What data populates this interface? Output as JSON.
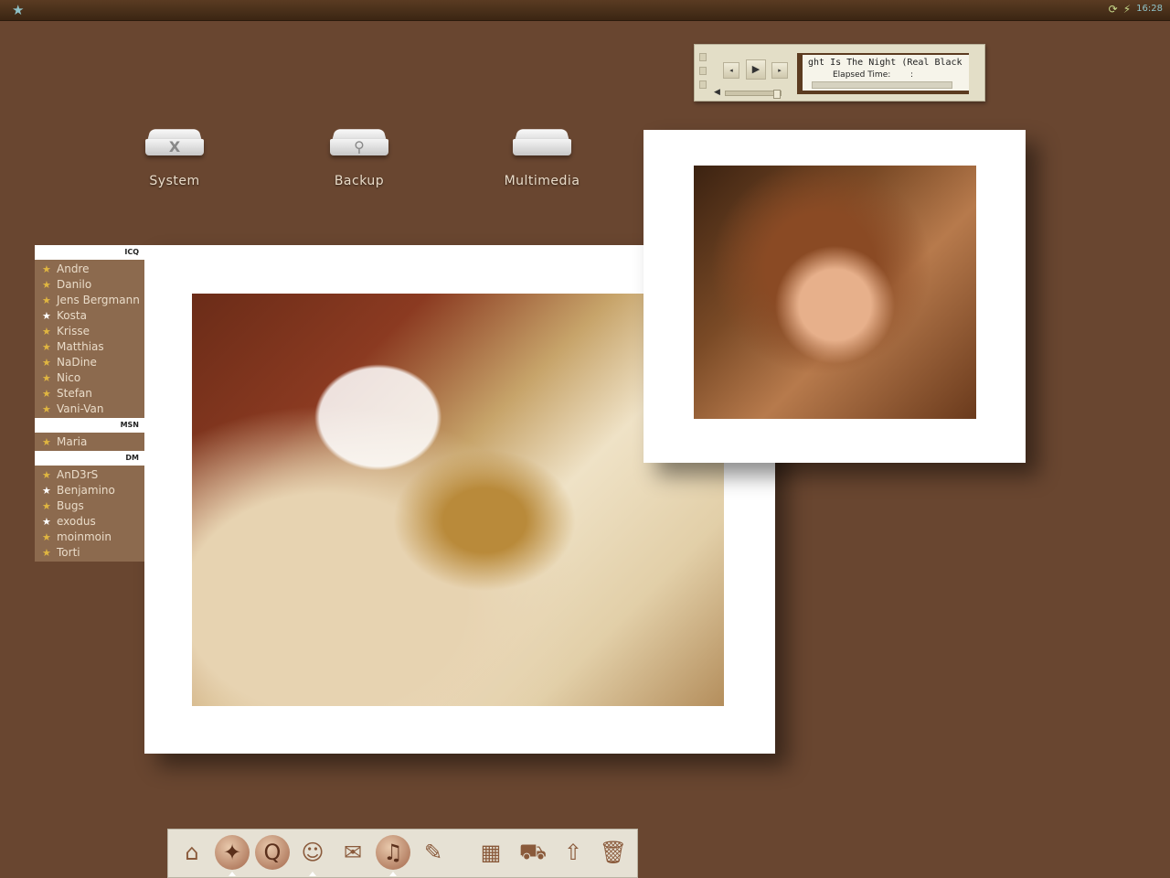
{
  "menubar": {
    "left_icon": "star-icon",
    "tray": [
      {
        "icon": "refresh-icon",
        "glyph": "⟳"
      },
      {
        "icon": "lightning-icon",
        "glyph": "⚡"
      }
    ],
    "clock": "16:28"
  },
  "player": {
    "title": "ght Is The Night (Real Black",
    "elapsed_label": "Elapsed Time:",
    "elapsed_value": ":",
    "controls": {
      "prev": "◂",
      "play": "▶",
      "next": "▸"
    },
    "volume_icon": "speaker-icon",
    "volume_level": 0.85,
    "progress": 0
  },
  "desktop": {
    "drives": [
      {
        "label": "System",
        "glyph": "X",
        "icon": "system-drive-icon"
      },
      {
        "label": "Backup",
        "glyph": "⚲",
        "icon": "backup-drive-icon"
      },
      {
        "label": "Multimedia",
        "glyph": "",
        "icon": "multimedia-drive-icon"
      }
    ]
  },
  "contacts": {
    "groups": [
      {
        "name": "ICQ",
        "items": [
          {
            "name": "Andre",
            "status": "away"
          },
          {
            "name": "Danilo",
            "status": "away"
          },
          {
            "name": "Jens Bergmann",
            "status": "away"
          },
          {
            "name": "Kosta",
            "status": "online"
          },
          {
            "name": "Krisse",
            "status": "away"
          },
          {
            "name": "Matthias",
            "status": "away"
          },
          {
            "name": "NaDine",
            "status": "away"
          },
          {
            "name": "Nico",
            "status": "away"
          },
          {
            "name": "Stefan",
            "status": "away"
          },
          {
            "name": "Vani-Van",
            "status": "away"
          }
        ]
      },
      {
        "name": "MSN",
        "items": [
          {
            "name": "Maria",
            "status": "away"
          }
        ]
      },
      {
        "name": "DM",
        "items": [
          {
            "name": "AnD3rS",
            "status": "away"
          },
          {
            "name": "Benjamino",
            "status": "online"
          },
          {
            "name": "Bugs",
            "status": "away"
          },
          {
            "name": "exodus",
            "status": "online"
          },
          {
            "name": "moinmoin",
            "status": "away"
          },
          {
            "name": "Torti",
            "status": "away"
          }
        ]
      }
    ],
    "status_glyph": "★",
    "colors": {
      "away": "#e0b640",
      "online": "#ffffff"
    }
  },
  "dock": {
    "items": [
      {
        "icon": "home-icon",
        "glyph": "⌂",
        "running": false
      },
      {
        "icon": "compass-icon",
        "glyph": "✦",
        "running": true
      },
      {
        "icon": "quicktime-icon",
        "glyph": "Q",
        "running": false
      },
      {
        "icon": "chat-buddy-icon",
        "glyph": "☺",
        "running": true
      },
      {
        "icon": "package-icon",
        "glyph": "✉",
        "running": false
      },
      {
        "icon": "music-disc-icon",
        "glyph": "♫",
        "running": true
      },
      {
        "icon": "feather-notes-icon",
        "glyph": "✎",
        "running": false
      },
      {
        "icon": "map-icon",
        "glyph": "▦",
        "running": false
      },
      {
        "icon": "delivery-truck-icon",
        "glyph": "⛟",
        "running": false
      },
      {
        "icon": "upload-box-icon",
        "glyph": "⇧",
        "running": false
      },
      {
        "icon": "trash-icon",
        "glyph": "🗑",
        "running": false
      }
    ]
  }
}
